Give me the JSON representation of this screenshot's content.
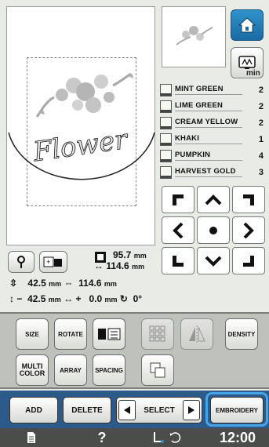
{
  "canvas": {
    "design_text": "Flower"
  },
  "nav": {
    "home_icon": "home-icon",
    "tv_icon": "tv-icon"
  },
  "threads": {
    "min_label": "min",
    "items": [
      {
        "name": "MINT GREEN",
        "count": "2"
      },
      {
        "name": "LIME GREEN",
        "count": "2"
      },
      {
        "name": "CREAM YELLOW",
        "count": "2"
      },
      {
        "name": "KHAKI",
        "count": "1"
      },
      {
        "name": "PUMPKIN",
        "count": "4"
      },
      {
        "name": "HARVEST GOLD",
        "count": "3"
      }
    ]
  },
  "size_info": {
    "height_value": "95.7",
    "width_value": "114.6",
    "unit": "mm"
  },
  "position_info": {
    "y_value": "42.5",
    "x_value": "114.6",
    "unit": "mm",
    "offset_y_sign": "−",
    "offset_y_value": "42.5",
    "offset_x_sign": "+",
    "offset_x_value": "0.0",
    "rotation": "0°"
  },
  "tools": {
    "size": "SIZE",
    "rotate": "ROTATE",
    "density": "DENSITY",
    "multi_color_1": "MULTI",
    "multi_color_2": "COLOR",
    "array": "ARRAY",
    "spacing": "SPACING"
  },
  "bottom": {
    "add": "ADD",
    "delete": "DELETE",
    "select": "SELECT",
    "embroidery": "EMBROIDERY"
  },
  "status": {
    "help": "?",
    "time": "12:00"
  },
  "colors": {
    "accent": "#2c5a8a",
    "highlight": "#4aa3e6"
  }
}
